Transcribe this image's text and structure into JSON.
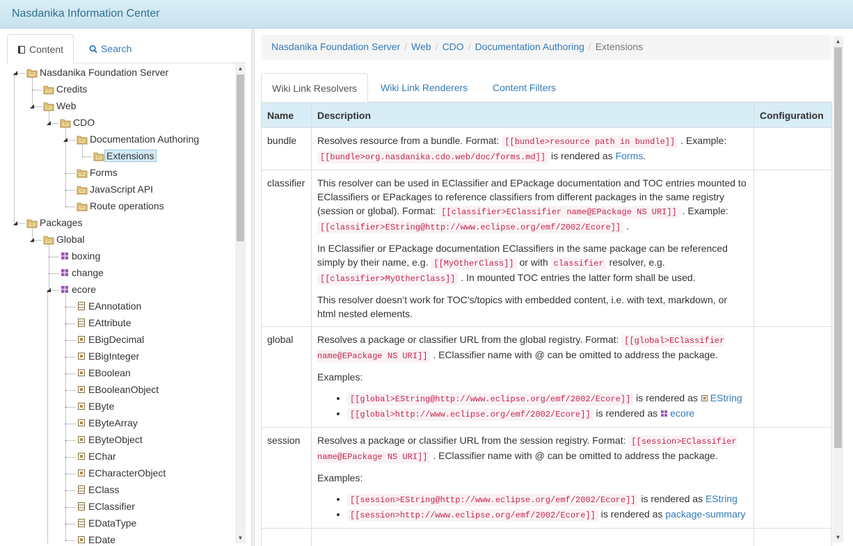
{
  "header": {
    "title": "Nasdanika Information Center"
  },
  "left_tabs": [
    {
      "label": "Content",
      "icon": "book-icon"
    },
    {
      "label": "Search",
      "icon": "search-icon"
    }
  ],
  "tree": [
    {
      "label": "Nasdanika Foundation Server",
      "icon": "folder-icon"
    },
    {
      "label": "Credits",
      "icon": "folder-icon"
    },
    {
      "label": "Web",
      "icon": "folder-icon"
    },
    {
      "label": "CDO",
      "icon": "folder-icon"
    },
    {
      "label": "Documentation Authoring",
      "icon": "folder-icon"
    },
    {
      "label": "Extensions",
      "icon": "folder-icon",
      "selected": true
    },
    {
      "label": "Forms",
      "icon": "folder-icon"
    },
    {
      "label": "JavaScript API",
      "icon": "folder-icon"
    },
    {
      "label": "Route operations",
      "icon": "folder-icon"
    },
    {
      "label": "Packages",
      "icon": "folder-icon"
    },
    {
      "label": "Global",
      "icon": "folder-icon"
    },
    {
      "label": "boxing",
      "icon": "package-icon"
    },
    {
      "label": "change",
      "icon": "package-icon"
    },
    {
      "label": "ecore",
      "icon": "package-icon"
    },
    {
      "label": "EAnnotation",
      "icon": "class-icon"
    },
    {
      "label": "EAttribute",
      "icon": "class-icon"
    },
    {
      "label": "EBigDecimal",
      "icon": "datatype-icon"
    },
    {
      "label": "EBigInteger",
      "icon": "datatype-icon"
    },
    {
      "label": "EBoolean",
      "icon": "datatype-icon"
    },
    {
      "label": "EBooleanObject",
      "icon": "datatype-icon"
    },
    {
      "label": "EByte",
      "icon": "datatype-icon"
    },
    {
      "label": "EByteArray",
      "icon": "datatype-icon"
    },
    {
      "label": "EByteObject",
      "icon": "datatype-icon"
    },
    {
      "label": "EChar",
      "icon": "datatype-icon"
    },
    {
      "label": "ECharacterObject",
      "icon": "datatype-icon"
    },
    {
      "label": "EClass",
      "icon": "class-icon"
    },
    {
      "label": "EClassifier",
      "icon": "class-icon"
    },
    {
      "label": "EDataType",
      "icon": "class-icon"
    },
    {
      "label": "EDate",
      "icon": "datatype-icon"
    }
  ],
  "breadcrumb": {
    "items": [
      "Nasdanika Foundation Server",
      "Web",
      "CDO",
      "Documentation Authoring"
    ],
    "separator": "/",
    "current": "Extensions"
  },
  "content_tabs": [
    "Wiki Link Resolvers",
    "Wiki Link Renderers",
    "Content Filters"
  ],
  "table": {
    "headers": {
      "name": "Name",
      "description": "Description",
      "configuration": "Configuration"
    },
    "rows": {
      "bundle": {
        "name": "bundle",
        "t1": "Resolves resource from a bundle. Format: ",
        "c1": "[[bundle>resource path in bundle]]",
        "t2": " . Example: ",
        "c2": "[[bundle>org.nasdanika.cdo.web/doc/forms.md]]",
        "t3": " is rendered as ",
        "link": "Forms",
        "t4": "."
      },
      "classifier": {
        "name": "classifier",
        "p1_t1": "This resolver can be used in EClassifier and EPackage documentation and TOC entries mounted to EClassifiers or EPackages to reference classifiers from different packages in the same registry (session or global). Format: ",
        "p1_c1": "[[classifier>EClassifier name@EPackage NS URI]]",
        "p1_t2": " . Example: ",
        "p1_c2": "[[classifier>EString@http://www.eclipse.org/emf/2002/Ecore]]",
        "p1_t3": " .",
        "p2_t1": "In EClassifier or EPackage documentation EClassifiers in the same package can be referenced simply by their name, e.g. ",
        "p2_c1": "[[MyOtherClass]]",
        "p2_t2": " or with ",
        "p2_c2": "classifier",
        "p2_t3": " resolver, e.g. ",
        "p2_c3": "[[classifier>MyOtherClass]]",
        "p2_t4": " . In mounted TOC entries the latter form shall be used.",
        "p3": "This resolver doesn’t work for TOC’s/topics with embedded content, i.e. with text, markdown, or html nested elements."
      },
      "global": {
        "name": "global",
        "t1": "Resolves a package or classifier URL from the global registry. Format: ",
        "c1": "[[global>EClassifier name@EPackage NS URI]]",
        "t2": " . EClassifier name with @ can be omitted to address the package.",
        "examples_label": "Examples:",
        "ex1_code": "[[global>EString@http://www.eclipse.org/emf/2002/Ecore]]",
        "ex1_text": " is rendered as ",
        "ex1_link": "EString",
        "ex1_icon": "datatype-icon",
        "ex2_code": "[[global>http://www.eclipse.org/emf/2002/Ecore]]",
        "ex2_text": " is rendered as ",
        "ex2_link": "ecore",
        "ex2_icon": "package-icon"
      },
      "session": {
        "name": "session",
        "t1": "Resolves a package or classifier URL from the session registry. Format: ",
        "c1": "[[session>EClassifier name@EPackage NS URI]]",
        "t2": " . EClassifier name with @ can be omitted to address the package.",
        "examples_label": "Examples:",
        "ex1_code": "[[session>EString@http://www.eclipse.org/emf/2002/Ecore]]",
        "ex1_text": " is rendered as ",
        "ex1_link": "EString",
        "ex2_code": "[[session>http://www.eclipse.org/emf/2002/Ecore]]",
        "ex2_text": " is rendered as ",
        "ex2_link": "package-summary"
      }
    }
  },
  "colors": {
    "header_bg": "#d9edf7",
    "link": "#337ab7",
    "code": "#c7254e",
    "selection": "#d4ebf7"
  }
}
